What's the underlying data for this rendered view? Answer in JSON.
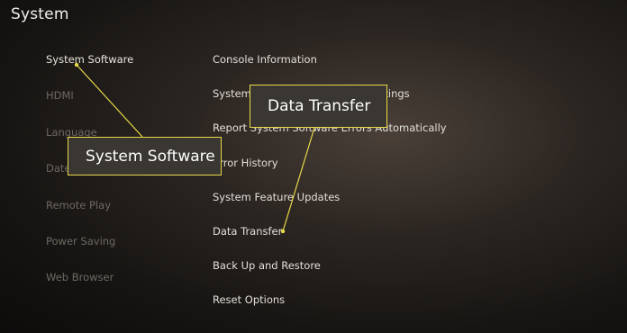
{
  "header": {
    "title": "System"
  },
  "sidebar": {
    "items": [
      {
        "label": "System Software",
        "active": true
      },
      {
        "label": "HDMI"
      },
      {
        "label": "Language"
      },
      {
        "label": "Date and Time"
      },
      {
        "label": "Remote Play"
      },
      {
        "label": "Power Saving"
      },
      {
        "label": "Web Browser"
      }
    ]
  },
  "main": {
    "items": [
      {
        "label": "Console Information"
      },
      {
        "label": "System Software Update and Settings"
      },
      {
        "label": "Report System Software Errors Automatically"
      },
      {
        "label": "Error History"
      },
      {
        "label": "System Feature Updates"
      },
      {
        "label": "Data Transfer"
      },
      {
        "label": "Back Up and Restore"
      },
      {
        "label": "Reset Options"
      }
    ]
  },
  "callouts": {
    "system_software": "System Software",
    "data_transfer": "Data Transfer"
  },
  "colors": {
    "accent": "#e8d94a",
    "callout_background": "#3a3631",
    "background": "#2c2622",
    "inactive_text": "#6e6862"
  }
}
